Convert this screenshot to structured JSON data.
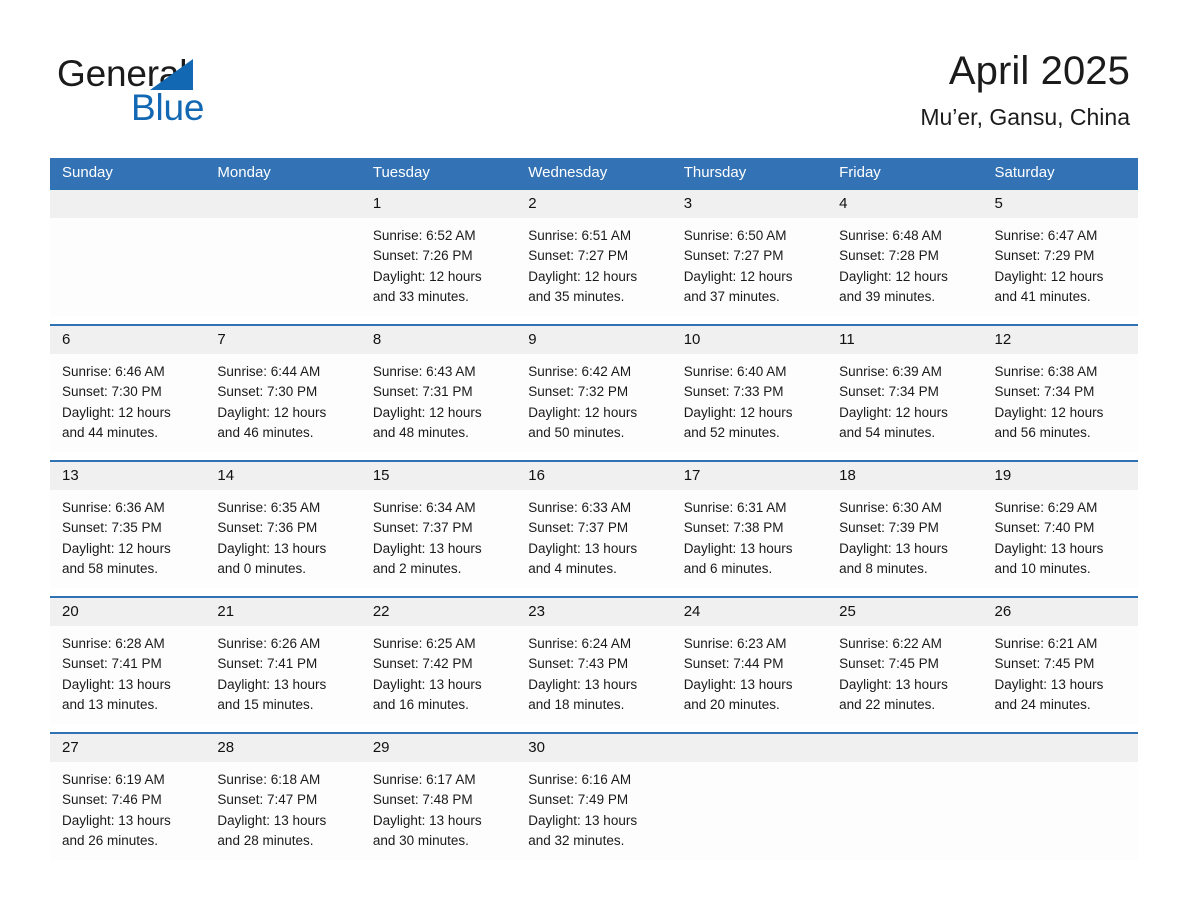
{
  "brand": {
    "name_part1": "General",
    "name_part2": "Blue",
    "triangle_color": "#1268b3",
    "accent_color": "#1268b3"
  },
  "header": {
    "title": "April 2025",
    "subtitle": "Mu’er, Gansu, China"
  },
  "theme": {
    "header_blue": "#3372b5",
    "row_rule_blue": "#2e74b5",
    "date_band_gray": "#f0f0f0",
    "cell_background": "#fdfdfd",
    "text_color": "#1a1a1a"
  },
  "weekdays": [
    "Sunday",
    "Monday",
    "Tuesday",
    "Wednesday",
    "Thursday",
    "Friday",
    "Saturday"
  ],
  "weeks": [
    {
      "days": [
        {
          "num": "",
          "detail": ""
        },
        {
          "num": "",
          "detail": ""
        },
        {
          "num": "1",
          "detail": "Sunrise: 6:52 AM\nSunset: 7:26 PM\nDaylight: 12 hours\nand 33 minutes."
        },
        {
          "num": "2",
          "detail": "Sunrise: 6:51 AM\nSunset: 7:27 PM\nDaylight: 12 hours\nand 35 minutes."
        },
        {
          "num": "3",
          "detail": "Sunrise: 6:50 AM\nSunset: 7:27 PM\nDaylight: 12 hours\nand 37 minutes."
        },
        {
          "num": "4",
          "detail": "Sunrise: 6:48 AM\nSunset: 7:28 PM\nDaylight: 12 hours\nand 39 minutes."
        },
        {
          "num": "5",
          "detail": "Sunrise: 6:47 AM\nSunset: 7:29 PM\nDaylight: 12 hours\nand 41 minutes."
        }
      ]
    },
    {
      "days": [
        {
          "num": "6",
          "detail": "Sunrise: 6:46 AM\nSunset: 7:30 PM\nDaylight: 12 hours\nand 44 minutes."
        },
        {
          "num": "7",
          "detail": "Sunrise: 6:44 AM\nSunset: 7:30 PM\nDaylight: 12 hours\nand 46 minutes."
        },
        {
          "num": "8",
          "detail": "Sunrise: 6:43 AM\nSunset: 7:31 PM\nDaylight: 12 hours\nand 48 minutes."
        },
        {
          "num": "9",
          "detail": "Sunrise: 6:42 AM\nSunset: 7:32 PM\nDaylight: 12 hours\nand 50 minutes."
        },
        {
          "num": "10",
          "detail": "Sunrise: 6:40 AM\nSunset: 7:33 PM\nDaylight: 12 hours\nand 52 minutes."
        },
        {
          "num": "11",
          "detail": "Sunrise: 6:39 AM\nSunset: 7:34 PM\nDaylight: 12 hours\nand 54 minutes."
        },
        {
          "num": "12",
          "detail": "Sunrise: 6:38 AM\nSunset: 7:34 PM\nDaylight: 12 hours\nand 56 minutes."
        }
      ]
    },
    {
      "days": [
        {
          "num": "13",
          "detail": "Sunrise: 6:36 AM\nSunset: 7:35 PM\nDaylight: 12 hours\nand 58 minutes."
        },
        {
          "num": "14",
          "detail": "Sunrise: 6:35 AM\nSunset: 7:36 PM\nDaylight: 13 hours\nand 0 minutes."
        },
        {
          "num": "15",
          "detail": "Sunrise: 6:34 AM\nSunset: 7:37 PM\nDaylight: 13 hours\nand 2 minutes."
        },
        {
          "num": "16",
          "detail": "Sunrise: 6:33 AM\nSunset: 7:37 PM\nDaylight: 13 hours\nand 4 minutes."
        },
        {
          "num": "17",
          "detail": "Sunrise: 6:31 AM\nSunset: 7:38 PM\nDaylight: 13 hours\nand 6 minutes."
        },
        {
          "num": "18",
          "detail": "Sunrise: 6:30 AM\nSunset: 7:39 PM\nDaylight: 13 hours\nand 8 minutes."
        },
        {
          "num": "19",
          "detail": "Sunrise: 6:29 AM\nSunset: 7:40 PM\nDaylight: 13 hours\nand 10 minutes."
        }
      ]
    },
    {
      "days": [
        {
          "num": "20",
          "detail": "Sunrise: 6:28 AM\nSunset: 7:41 PM\nDaylight: 13 hours\nand 13 minutes."
        },
        {
          "num": "21",
          "detail": "Sunrise: 6:26 AM\nSunset: 7:41 PM\nDaylight: 13 hours\nand 15 minutes."
        },
        {
          "num": "22",
          "detail": "Sunrise: 6:25 AM\nSunset: 7:42 PM\nDaylight: 13 hours\nand 16 minutes."
        },
        {
          "num": "23",
          "detail": "Sunrise: 6:24 AM\nSunset: 7:43 PM\nDaylight: 13 hours\nand 18 minutes."
        },
        {
          "num": "24",
          "detail": "Sunrise: 6:23 AM\nSunset: 7:44 PM\nDaylight: 13 hours\nand 20 minutes."
        },
        {
          "num": "25",
          "detail": "Sunrise: 6:22 AM\nSunset: 7:45 PM\nDaylight: 13 hours\nand 22 minutes."
        },
        {
          "num": "26",
          "detail": "Sunrise: 6:21 AM\nSunset: 7:45 PM\nDaylight: 13 hours\nand 24 minutes."
        }
      ]
    },
    {
      "days": [
        {
          "num": "27",
          "detail": "Sunrise: 6:19 AM\nSunset: 7:46 PM\nDaylight: 13 hours\nand 26 minutes."
        },
        {
          "num": "28",
          "detail": "Sunrise: 6:18 AM\nSunset: 7:47 PM\nDaylight: 13 hours\nand 28 minutes."
        },
        {
          "num": "29",
          "detail": "Sunrise: 6:17 AM\nSunset: 7:48 PM\nDaylight: 13 hours\nand 30 minutes."
        },
        {
          "num": "30",
          "detail": "Sunrise: 6:16 AM\nSunset: 7:49 PM\nDaylight: 13 hours\nand 32 minutes."
        },
        {
          "num": "",
          "detail": ""
        },
        {
          "num": "",
          "detail": ""
        },
        {
          "num": "",
          "detail": ""
        }
      ]
    }
  ]
}
